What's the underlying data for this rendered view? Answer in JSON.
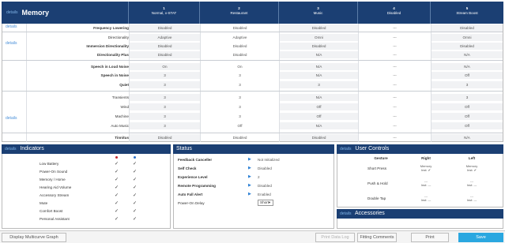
{
  "memory": {
    "details_label": "details",
    "title": "Memory",
    "columns": [
      {
        "num": "1",
        "name": "Normal, x-STAT"
      },
      {
        "num": "2",
        "name": "Restaurant"
      },
      {
        "num": "3",
        "name": "Music"
      },
      {
        "num": "4",
        "name": "Disabled"
      },
      {
        "num": "5",
        "name": "Stream Boost"
      }
    ],
    "rows": [
      {
        "label": "Frequency Lowering",
        "values": [
          "Disabled",
          "Disabled",
          "Disabled",
          "---",
          "Disabled"
        ]
      },
      {
        "label": "Directionality",
        "values": [
          "Adaptive",
          "Adaptive",
          "Omni",
          "---",
          "Omni"
        ]
      },
      {
        "label": "Immersion Directionality",
        "values": [
          "Disabled",
          "Disabled",
          "Disabled",
          "---",
          "Disabled"
        ]
      },
      {
        "label": "Directionality Plus",
        "values": [
          "Disabled",
          "Disabled",
          "N/A",
          "---",
          "N/A"
        ]
      },
      {
        "label": "Speech in Loud Noise",
        "values": [
          "On",
          "On",
          "N/A",
          "---",
          "N/A"
        ]
      },
      {
        "label": "Speech in Noise",
        "values": [
          "3",
          "3",
          "N/A",
          "---",
          "Off"
        ]
      },
      {
        "label": "Quiet",
        "values": [
          "3",
          "3",
          "3",
          "---",
          "3"
        ]
      },
      {
        "label": "Transients",
        "values": [
          "3",
          "3",
          "N/A",
          "---",
          "3"
        ]
      },
      {
        "label": "Wind",
        "values": [
          "3",
          "3",
          "Off",
          "---",
          "Off"
        ]
      },
      {
        "label": "Machine",
        "values": [
          "3",
          "3",
          "Off",
          "---",
          "Off"
        ]
      },
      {
        "label": "Auto Music",
        "values": [
          "3",
          "Off",
          "N/A",
          "---",
          "Off"
        ]
      },
      {
        "label": "Tinnitus",
        "values": [
          "Disabled",
          "Disabled",
          "Disabled",
          "---",
          "N/A"
        ]
      }
    ]
  },
  "indicators": {
    "details_label": "details",
    "title": "Indicators",
    "ear_colors": {
      "left": "#c0262d",
      "right": "#2a6fc9"
    },
    "check": "✓",
    "items": [
      "Low Battery",
      "Power-On Sound",
      "Memory / Home",
      "Hearing Aid Volume",
      "Accessory Stream",
      "Mute",
      "Comfort Boost",
      "Personal Assistant"
    ]
  },
  "status": {
    "title": "Status",
    "arrow": "▶",
    "rows": [
      {
        "label": "Feedback Canceller",
        "value": "Not Initialized"
      },
      {
        "label": "Self Check",
        "value": "Disabled"
      },
      {
        "label": "Experience Level",
        "value": "2"
      },
      {
        "label": "Remote Programming",
        "value": "Disabled"
      },
      {
        "label": "Auto Fall Alert",
        "value": "Enabled"
      }
    ],
    "power_on_delay": {
      "label": "Power-On Delay",
      "value": "Short"
    }
  },
  "user_controls": {
    "details_label": "details",
    "title": "User Controls",
    "headers": [
      "Gesture",
      "Right",
      "Left"
    ],
    "rows": [
      {
        "gesture": "Short Press",
        "right": [
          "Memory",
          "Inst: ✔"
        ],
        "left": [
          "Memory",
          "Inst: ✔"
        ]
      },
      {
        "gesture": "Push & Hold",
        "right": [
          "---",
          "Inst: ---"
        ],
        "left": [
          "---",
          "Inst: ---"
        ]
      },
      {
        "gesture": "Double Tap",
        "right": [
          "---",
          "Inst: ---"
        ],
        "left": [
          "---",
          "Inst: ---"
        ]
      }
    ]
  },
  "accessories": {
    "details_label": "details",
    "title": "Accessories"
  },
  "bottom_bar": {
    "display_multicurve": "Display Multicurve Graph",
    "print_data_log": "Print Data Log",
    "fitting_comments": "Fitting Comments",
    "print": "Print",
    "save": "Save"
  },
  "colors": {
    "header_navy": "#1b3f73",
    "accent_blue": "#2aa7e0"
  }
}
